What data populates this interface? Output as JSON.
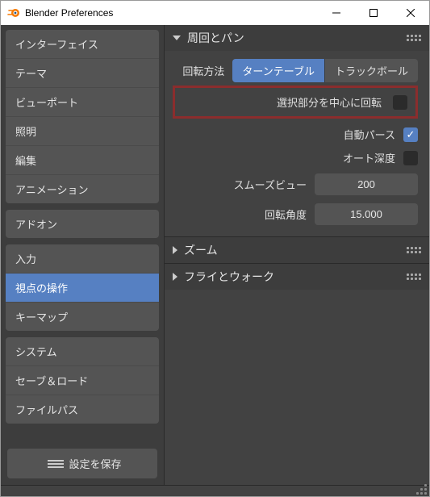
{
  "window": {
    "title": "Blender Preferences"
  },
  "sidebar": {
    "groups": [
      {
        "items": [
          {
            "label": "インターフェイス"
          },
          {
            "label": "テーマ"
          },
          {
            "label": "ビューポート"
          },
          {
            "label": "照明"
          },
          {
            "label": "編集"
          },
          {
            "label": "アニメーション"
          }
        ]
      },
      {
        "items": [
          {
            "label": "アドオン"
          }
        ]
      },
      {
        "items": [
          {
            "label": "入力"
          },
          {
            "label": "視点の操作",
            "active": true
          },
          {
            "label": "キーマップ"
          }
        ]
      },
      {
        "items": [
          {
            "label": "システム"
          },
          {
            "label": "セーブ＆ロード"
          },
          {
            "label": "ファイルパス"
          }
        ]
      }
    ],
    "save_button": "設定を保存"
  },
  "panels": {
    "orbit_pan": {
      "title": "周回とパン",
      "rotation_method_label": "回転方法",
      "rotation_options": [
        {
          "label": "ターンテーブル",
          "active": true
        },
        {
          "label": "トラックボール",
          "active": false
        }
      ],
      "rotate_around_selection_label": "選択部分を中心に回転",
      "rotate_around_selection_checked": false,
      "auto_perspective_label": "自動パース",
      "auto_perspective_checked": true,
      "auto_depth_label": "オート深度",
      "auto_depth_checked": false,
      "smooth_view_label": "スムーズビュー",
      "smooth_view_value": "200",
      "rotation_angle_label": "回転角度",
      "rotation_angle_value": "15.000"
    },
    "zoom": {
      "title": "ズーム"
    },
    "fly_walk": {
      "title": "フライとウォーク"
    }
  }
}
